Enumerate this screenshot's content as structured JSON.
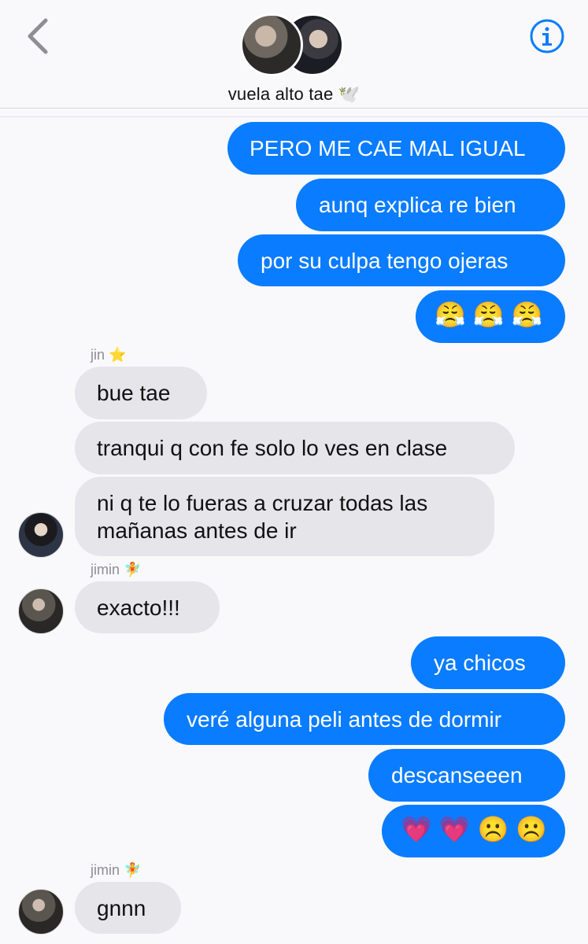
{
  "header": {
    "title": "vuela alto tae 🕊️",
    "back_icon": "back-chevron-icon",
    "info_icon": "info-icon"
  },
  "messages": [
    {
      "from": "me",
      "text": "PERO ME CAE MAL IGUAL"
    },
    {
      "from": "me",
      "text": "aunq explica re bien"
    },
    {
      "from": "me",
      "text": "por su culpa tengo ojeras"
    },
    {
      "from": "me",
      "text": "😤 😤 😤"
    },
    {
      "from": "jin",
      "sender_label": "jin ⭐",
      "text": "bue tae"
    },
    {
      "from": "jin",
      "text": "tranqui q con fe solo lo ves en clase"
    },
    {
      "from": "jin",
      "text": "ni q te lo fueras a cruzar todas las\nmañanas antes de ir"
    },
    {
      "from": "jimin",
      "sender_label": "jimin 🧚",
      "text": "exacto!!!"
    },
    {
      "from": "me",
      "text": "ya chicos"
    },
    {
      "from": "me",
      "text": "veré alguna peli antes de dormir"
    },
    {
      "from": "me",
      "text": "descanseeen"
    },
    {
      "from": "me",
      "text": "💗 💗 ☹️ ☹️"
    },
    {
      "from": "jimin",
      "sender_label": "jimin 🧚",
      "text": "gnnn"
    }
  ]
}
